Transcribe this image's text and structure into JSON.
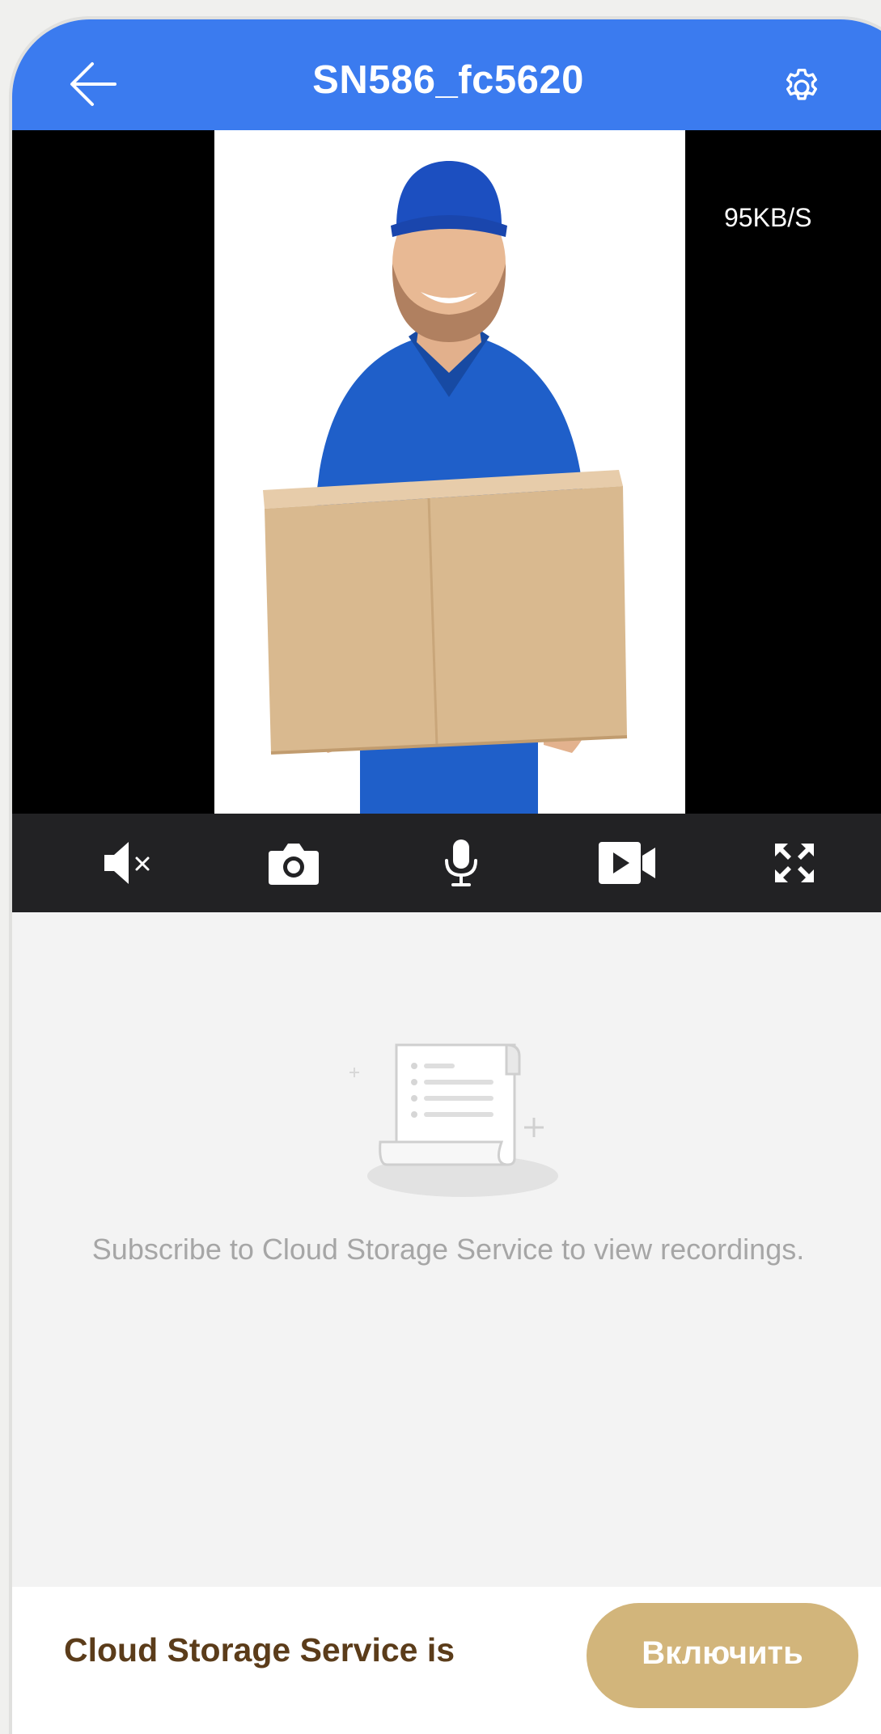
{
  "header": {
    "title": "SN586_fc5620",
    "back_icon": "arrow-left-icon",
    "settings_icon": "gear-icon",
    "color": "#3b7bef"
  },
  "video": {
    "bitrate": "95KB/S"
  },
  "controls": [
    {
      "icon": "mute-icon"
    },
    {
      "icon": "camera-icon"
    },
    {
      "icon": "microphone-icon"
    },
    {
      "icon": "record-video-icon"
    },
    {
      "icon": "fullscreen-icon"
    }
  ],
  "empty_state": {
    "icon": "document-scroll-icon",
    "message": "Subscribe to Cloud Storage Service to view recordings."
  },
  "promo": {
    "text": "Cloud Storage Service is",
    "button_label": "Включить",
    "button_color": "#d2b57b"
  }
}
